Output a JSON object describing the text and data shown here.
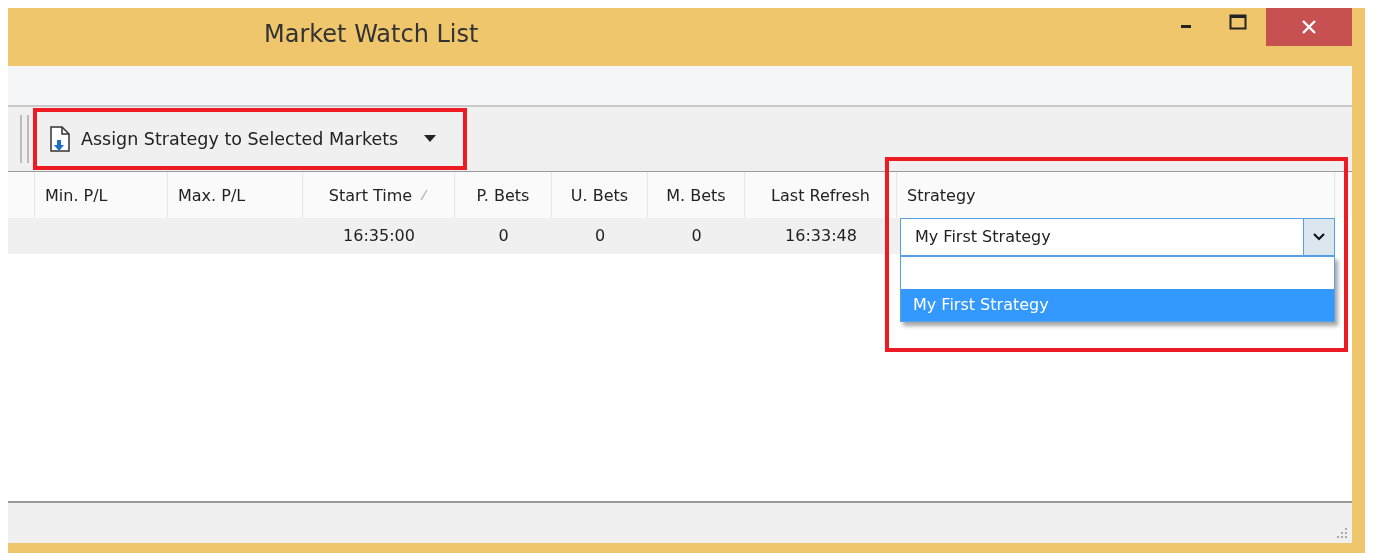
{
  "window": {
    "title": "Market Watch List"
  },
  "toolbar": {
    "button": {
      "label": "Assign Strategy to Selected Markets",
      "has_menu": true
    }
  },
  "table": {
    "columns": [
      {
        "kind": "blank"
      },
      {
        "kind": "text",
        "label": "Min. P/L",
        "sorted": false
      },
      {
        "kind": "text",
        "label": "Max. P/L",
        "sorted": false
      },
      {
        "kind": "text",
        "label": "Start Time",
        "sorted": true
      },
      {
        "kind": "text",
        "label": "P. Bets",
        "sorted": false
      },
      {
        "kind": "text",
        "label": "U. Bets",
        "sorted": false
      },
      {
        "kind": "text",
        "label": "M. Bets",
        "sorted": false
      },
      {
        "kind": "text",
        "label": "Last Refresh",
        "sorted": false
      },
      {
        "kind": "combo",
        "label": "Strategy",
        "sorted": false
      }
    ],
    "rows": [
      {
        "cells": [
          null,
          null,
          null,
          "16:35:00",
          "0",
          "0",
          "0",
          "16:33:48",
          "My First Strategy"
        ],
        "selected": false
      }
    ]
  },
  "dropdown": {
    "expanded": true,
    "options": [
      {
        "kind": "blank",
        "selected": false
      },
      {
        "kind": "item",
        "label": "My First Strategy",
        "selected": true
      }
    ]
  },
  "highlights": {
    "toolbar_button": {
      "color": "#ed1c24"
    },
    "strategy_dropdown": {
      "color": "#ed1c24"
    }
  }
}
